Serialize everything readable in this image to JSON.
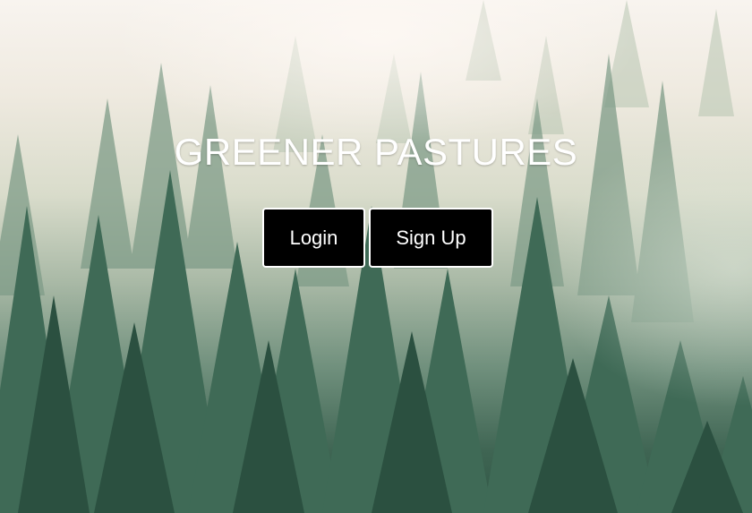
{
  "page": {
    "title": "GREENER PASTURES"
  },
  "actions": {
    "login_label": "Login",
    "signup_label": "Sign Up"
  },
  "colors": {
    "button_bg": "#000000",
    "button_text": "#ffffff",
    "button_border": "#ffffff",
    "title_text": "#ffffff",
    "forest_dark": "#2f5544",
    "fog_light": "#f8f4ef"
  }
}
